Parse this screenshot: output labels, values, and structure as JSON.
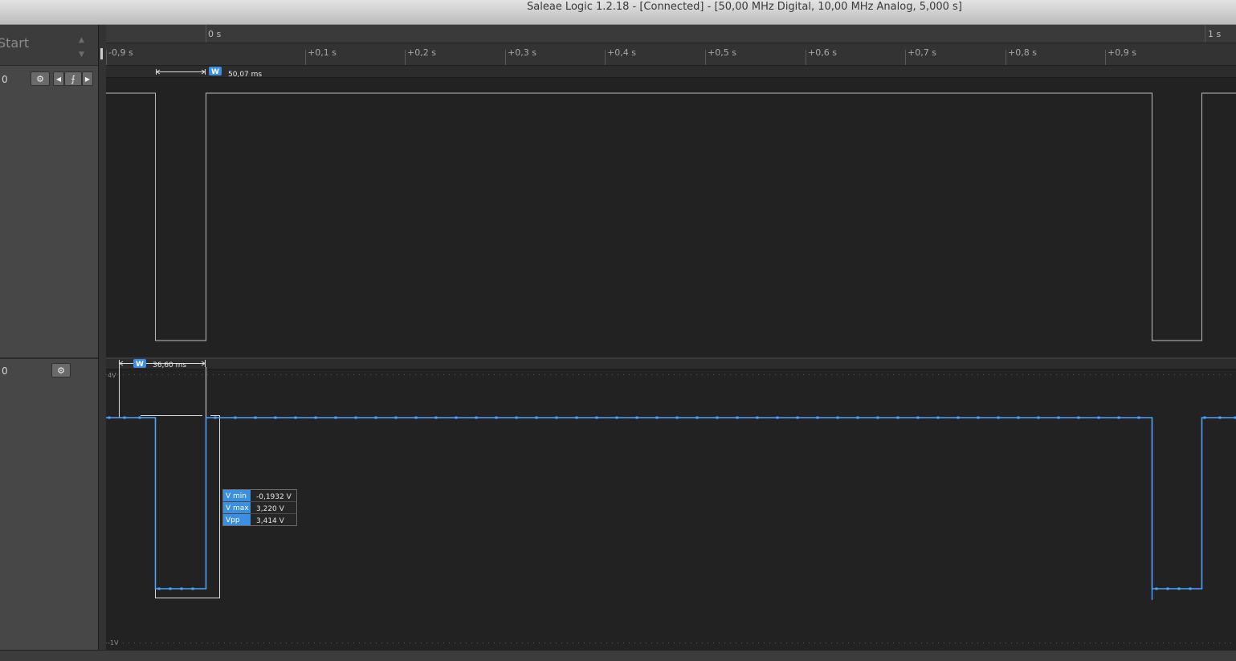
{
  "window": {
    "title": "Saleae Logic 1.2.18 - [Connected] - [50,00 MHz Digital, 10,00 MHz Analog, 5,000 s]"
  },
  "left_panel": {
    "start_label": "Start",
    "channels": [
      {
        "number": "0"
      },
      {
        "number": "0"
      }
    ]
  },
  "timeline": {
    "top_labels": [
      "0 s",
      "1 s"
    ],
    "ticks": [
      "-0,9 s",
      "+0,1 s",
      "+0,2 s",
      "+0,3 s",
      "+0,4 s",
      "+0,5 s",
      "+0,6 s",
      "+0,7 s",
      "+0,8 s",
      "+0,9 s"
    ]
  },
  "digital": {
    "width_badge": "W",
    "width_value": "50,07 ms"
  },
  "analog": {
    "width_badge": "W",
    "width_value": "36,60 ms",
    "axis_top": "4V",
    "axis_bottom": "-1V",
    "measurements": [
      {
        "label": "V min",
        "value": "-0,1932 V"
      },
      {
        "label": "V max",
        "value": "3,220 V"
      },
      {
        "label": "Vpp",
        "value": "3,414 V"
      }
    ]
  },
  "colors": {
    "digital_trace": "#bdbdbd",
    "analog_trace": "#4ea3ff",
    "badge": "#3b8fe0",
    "plot_bg": "#222222"
  }
}
